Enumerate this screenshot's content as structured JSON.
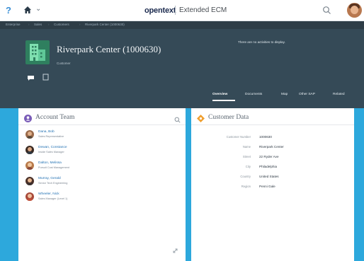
{
  "shell": {
    "help_label": "?",
    "brand": "opentext",
    "product": "Extended ECM"
  },
  "breadcrumb": [
    "Enterprise",
    "Sales",
    "Customers",
    "Riverpark Center (1000630)"
  ],
  "header": {
    "title": "Riverpark Center (1000630)",
    "subtitle": "Customer",
    "activity_text": "There are no activities to display.",
    "tabs": [
      {
        "label": "Overview",
        "active": true
      },
      {
        "label": "Documents",
        "active": false
      },
      {
        "label": "Map",
        "active": false
      },
      {
        "label": "Other SAP",
        "active": false
      },
      {
        "label": "Related",
        "active": false
      }
    ]
  },
  "account_team": {
    "title": "Account Team",
    "members": [
      {
        "name": "Dana, Bob",
        "role": "Sales Representative"
      },
      {
        "name": "Dewan, Constance",
        "role": "Inside Sales Manager"
      },
      {
        "name": "Dalton, Melissa",
        "role": "Pursuit Cost Management"
      },
      {
        "name": "Murray, Gerald",
        "role": "Senior Tech Engineering"
      },
      {
        "name": "Wheeler, Nick",
        "role": "Sales Manager (Level 1)"
      }
    ]
  },
  "customer_data": {
    "title": "Customer Data",
    "fields": [
      {
        "label": "Customer Number",
        "value": "1000630"
      },
      {
        "label": "Name",
        "value": "Riverpark Center"
      },
      {
        "label": "Street",
        "value": "22 Ryder Ave"
      },
      {
        "label": "City",
        "value": "Philadelphia"
      },
      {
        "label": "Country",
        "value": "United States"
      },
      {
        "label": "Region",
        "value": "Penni Gale"
      }
    ]
  },
  "colors": {
    "header_bg": "#354a57",
    "content_bg": "#2da8dc",
    "link": "#1f6fb2",
    "accent_orange": "#f0a030",
    "accent_purple": "#7a5cb8"
  }
}
